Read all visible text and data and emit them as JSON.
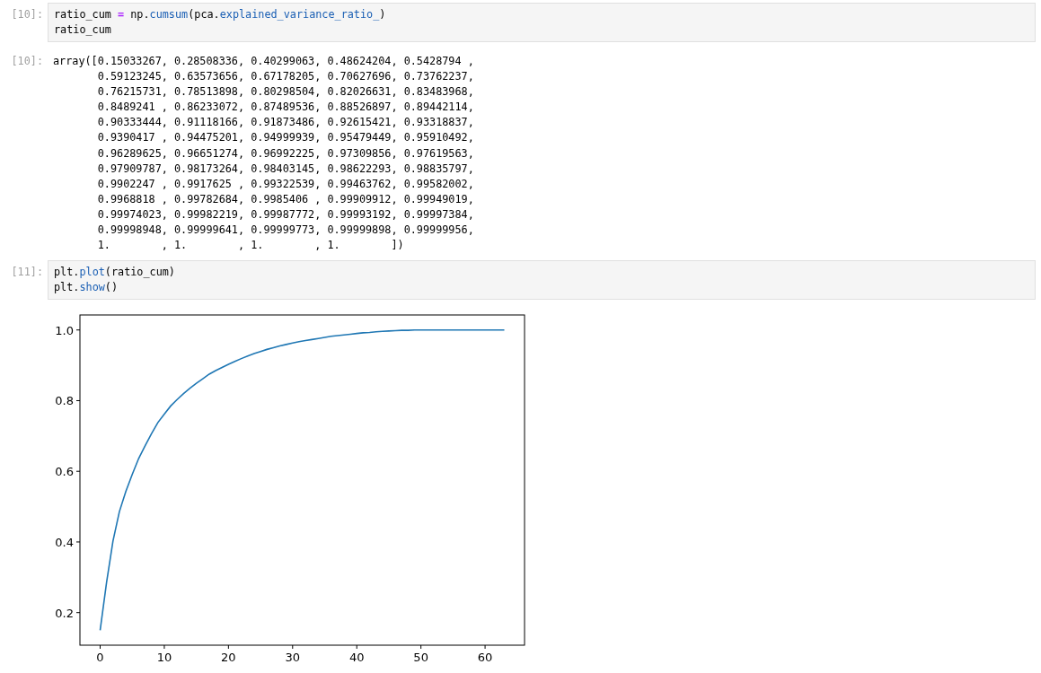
{
  "cells": [
    {
      "kind": "code",
      "prompt": "[10]:",
      "lines": [
        [
          {
            "text": "ratio_cum ",
            "kind": "plain"
          },
          {
            "text": "=",
            "kind": "op"
          },
          {
            "text": " np.",
            "kind": "plain"
          },
          {
            "text": "cumsum",
            "kind": "attr"
          },
          {
            "text": "(pca.",
            "kind": "plain"
          },
          {
            "text": "explained_variance_ratio_",
            "kind": "attr"
          },
          {
            "text": ")",
            "kind": "plain"
          }
        ],
        [
          {
            "text": "ratio_cum",
            "kind": "plain"
          }
        ]
      ]
    },
    {
      "kind": "text_output",
      "prompt": "[10]:",
      "lines": [
        "array([0.15033267, 0.28508336, 0.40299063, 0.48624204, 0.5428794 ,",
        "       0.59123245, 0.63573656, 0.67178205, 0.70627696, 0.73762237,",
        "       0.76215731, 0.78513898, 0.80298504, 0.82026631, 0.83483968,",
        "       0.8489241 , 0.86233072, 0.87489536, 0.88526897, 0.89442114,",
        "       0.90333444, 0.91118166, 0.91873486, 0.92615421, 0.93318837,",
        "       0.9390417 , 0.94475201, 0.94999939, 0.95479449, 0.95910492,",
        "       0.96289625, 0.96651274, 0.96992225, 0.97309856, 0.97619563,",
        "       0.97909787, 0.98173264, 0.98403145, 0.98622293, 0.98835797,",
        "       0.9902247 , 0.9917625 , 0.99322539, 0.99463762, 0.99582002,",
        "       0.9968818 , 0.99782684, 0.9985406 , 0.99909912, 0.99949019,",
        "       0.99974023, 0.99982219, 0.99987772, 0.99993192, 0.99997384,",
        "       0.99998948, 0.99999641, 0.99999773, 0.99999898, 0.99999956,",
        "       1.        , 1.        , 1.        , 1.        ])"
      ]
    },
    {
      "kind": "code",
      "prompt": "[11]:",
      "lines": [
        [
          {
            "text": "plt.",
            "kind": "plain"
          },
          {
            "text": "plot",
            "kind": "attr"
          },
          {
            "text": "(ratio_cum)",
            "kind": "plain"
          }
        ],
        [
          {
            "text": "plt.",
            "kind": "plain"
          },
          {
            "text": "show",
            "kind": "attr"
          },
          {
            "text": "()",
            "kind": "plain"
          }
        ]
      ]
    },
    {
      "kind": "plot_output",
      "chart_data": {
        "type": "line",
        "x": [
          0,
          1,
          2,
          3,
          4,
          5,
          6,
          7,
          8,
          9,
          10,
          11,
          12,
          13,
          14,
          15,
          16,
          17,
          18,
          19,
          20,
          21,
          22,
          23,
          24,
          25,
          26,
          27,
          28,
          29,
          30,
          31,
          32,
          33,
          34,
          35,
          36,
          37,
          38,
          39,
          40,
          41,
          42,
          43,
          44,
          45,
          46,
          47,
          48,
          49,
          50,
          51,
          52,
          53,
          54,
          55,
          56,
          57,
          58,
          59,
          60,
          61,
          62,
          63
        ],
        "series": [
          {
            "color": "#1f77b4",
            "values": [
              0.15,
              0.285,
              0.403,
              0.486,
              0.543,
              0.591,
              0.636,
              0.672,
              0.706,
              0.738,
              0.762,
              0.785,
              0.803,
              0.82,
              0.835,
              0.849,
              0.862,
              0.875,
              0.885,
              0.894,
              0.903,
              0.911,
              0.919,
              0.926,
              0.933,
              0.939,
              0.945,
              0.95,
              0.955,
              0.959,
              0.963,
              0.967,
              0.97,
              0.973,
              0.976,
              0.979,
              0.982,
              0.984,
              0.986,
              0.988,
              0.99,
              0.992,
              0.993,
              0.995,
              0.996,
              0.997,
              0.998,
              0.999,
              0.999,
              1,
              1,
              1,
              1,
              1,
              1,
              1,
              1,
              1,
              1,
              1,
              1,
              1,
              1,
              1
            ]
          }
        ],
        "xlim": [
          -3.15,
          66.15
        ],
        "ylim": [
          0.1078,
          1.0425
        ],
        "xticks": [
          0,
          10,
          20,
          30,
          40,
          50,
          60
        ],
        "yticks": [
          {
            "value": 0.2,
            "label": "0.2"
          },
          {
            "value": 0.4,
            "label": "0.4"
          },
          {
            "value": 0.6,
            "label": "0.6"
          },
          {
            "value": 0.8,
            "label": "0.8"
          },
          {
            "value": 1.0,
            "label": "1.0"
          }
        ]
      }
    }
  ]
}
